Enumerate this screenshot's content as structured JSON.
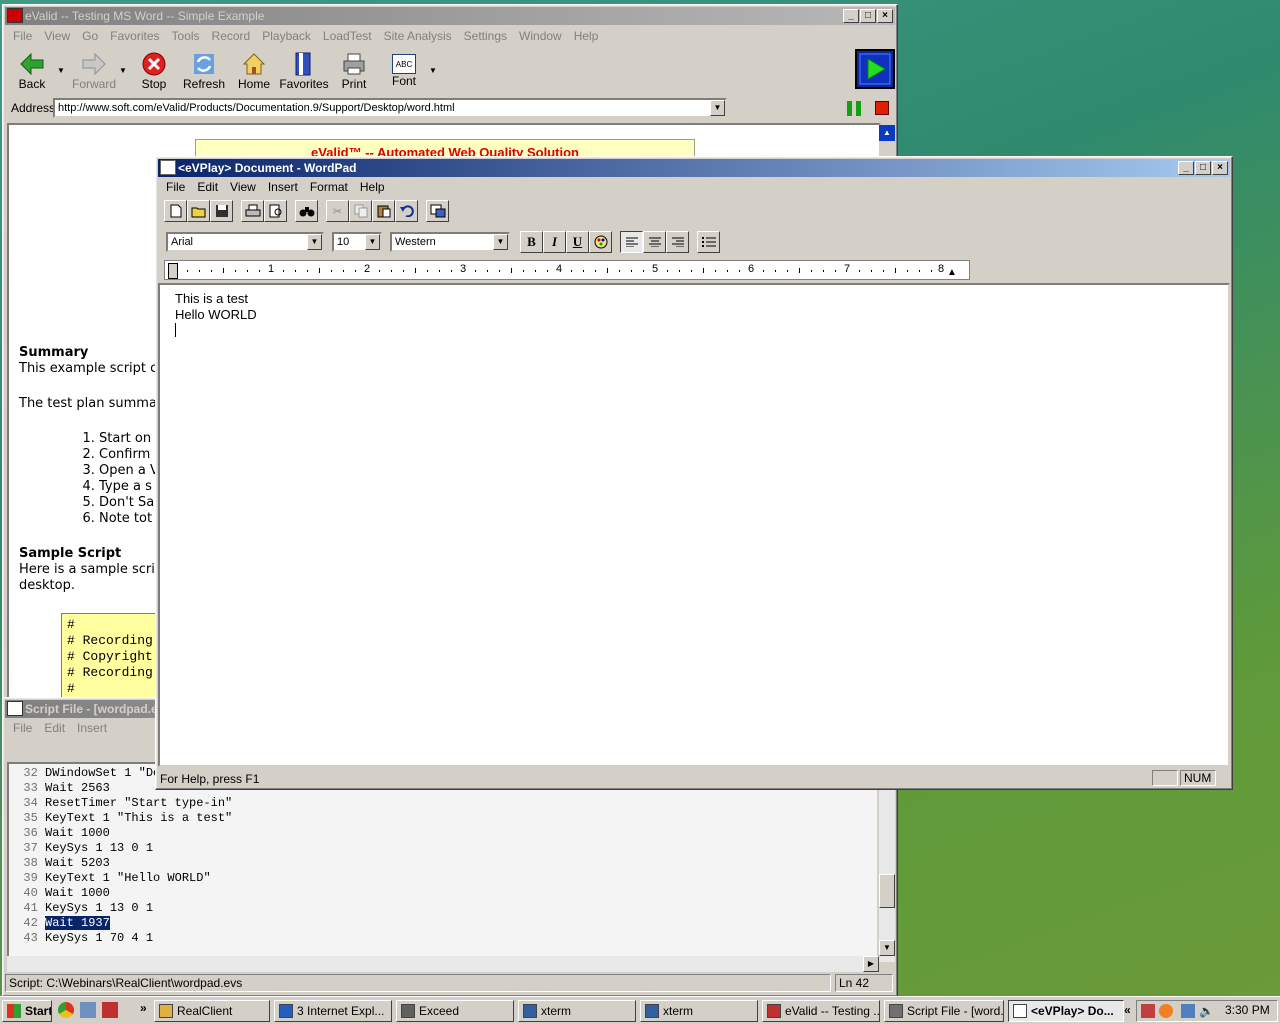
{
  "evalid": {
    "title": "eValid -- Testing MS Word -- Simple Example",
    "menu": [
      "File",
      "View",
      "Go",
      "Favorites",
      "Tools",
      "Record",
      "Playback",
      "LoadTest",
      "Site Analysis",
      "Settings",
      "Window",
      "Help"
    ],
    "toolbar": {
      "back": "Back",
      "forward": "Forward",
      "stop": "Stop",
      "refresh": "Refresh",
      "home": "Home",
      "favorites": "Favorites",
      "print": "Print",
      "font": "Font",
      "font_icon": "ABC"
    },
    "address_label": "Address",
    "address_value": "http://www.soft.com/eValid/Products/Documentation.9/Support/Desktop/word.html",
    "banner": "eValid™ -- Automated Web Quality Solution",
    "doc": {
      "summary_heading": "Summary",
      "summary_text": "This example script c",
      "plan_text": "The test plan summa",
      "plan_items": [
        "Start on",
        "Confirm",
        "Open a V",
        "Type a s",
        "Don't Sa",
        "Note tot"
      ],
      "sample_heading": "Sample Script",
      "sample_text1": "Here is a sample scri",
      "sample_text2": "desktop.",
      "code_lines": [
        "#",
        "# Recording",
        "# Copyright",
        "# Recording",
        "#"
      ]
    }
  },
  "wordpad": {
    "title": "<eVPlay> Document - WordPad",
    "menu": [
      "File",
      "Edit",
      "View",
      "Insert",
      "Format",
      "Help"
    ],
    "font": "Arial",
    "size": "10",
    "script": "Western",
    "bold": "B",
    "italic": "I",
    "underline": "U",
    "ruler": [
      "1",
      "2",
      "3",
      "4",
      "5",
      "6",
      "7",
      "8"
    ],
    "lines": [
      "This is a test",
      "Hello WORLD"
    ],
    "status_help": "For Help, press F1",
    "status_num": "NUM"
  },
  "script": {
    "title": "Script File - [wordpad.e",
    "menu": [
      "File",
      "Edit",
      "Insert"
    ],
    "lines": [
      {
        "n": "32",
        "t": "DWindowSet 1 \"Do"
      },
      {
        "n": "33",
        "t": "Wait 2563"
      },
      {
        "n": "34",
        "t": "ResetTimer \"Start type-in\""
      },
      {
        "n": "35",
        "t": "KeyText 1 \"This is a test\""
      },
      {
        "n": "36",
        "t": "Wait 1000"
      },
      {
        "n": "37",
        "t": "KeySys 1 13 0 1"
      },
      {
        "n": "38",
        "t": "Wait 5203"
      },
      {
        "n": "39",
        "t": "KeyText 1 \"Hello WORLD\""
      },
      {
        "n": "40",
        "t": "Wait 1000"
      },
      {
        "n": "41",
        "t": "KeySys 1 13 0 1"
      },
      {
        "n": "42",
        "t": "Wait 1937",
        "selected": true
      },
      {
        "n": "43",
        "t": "KeySys 1 70 4 1"
      }
    ],
    "status_path": "Script: C:\\Webinars\\RealClient\\wordpad.evs",
    "status_ln": "Ln 42"
  },
  "taskbar": {
    "start": "Start",
    "buttons": [
      {
        "label": "RealClient"
      },
      {
        "label": "3 Internet Expl..."
      },
      {
        "label": "Exceed"
      },
      {
        "label": "xterm"
      },
      {
        "label": "xterm"
      },
      {
        "label": "eValid -- Testing ..."
      },
      {
        "label": "Script File - [word..."
      },
      {
        "label": "<eVPlay> Do...",
        "active": true
      }
    ],
    "chevron": "»",
    "tray_chevron": "«",
    "clock": "3:30 PM"
  }
}
